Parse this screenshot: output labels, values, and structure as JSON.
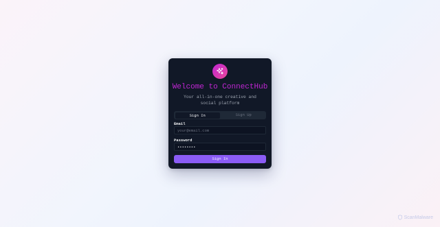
{
  "app": {
    "title": "Welcome to ConnectHub",
    "subtitle": "Your all-in-one creative and social platform",
    "logo_icon": "sparkles-icon"
  },
  "tabs": [
    {
      "label": "Sign In",
      "active": true
    },
    {
      "label": "Sign Up",
      "active": false
    }
  ],
  "form": {
    "email_label": "Email",
    "email_placeholder": "your@email.com",
    "email_value": "",
    "password_label": "Password",
    "password_value": "password",
    "submit_label": "Sign In"
  },
  "watermark": {
    "text": "ScanMalware"
  },
  "colors": {
    "accent": "#8b5cf6",
    "title": "#c026d3",
    "card_bg": "#111827"
  }
}
